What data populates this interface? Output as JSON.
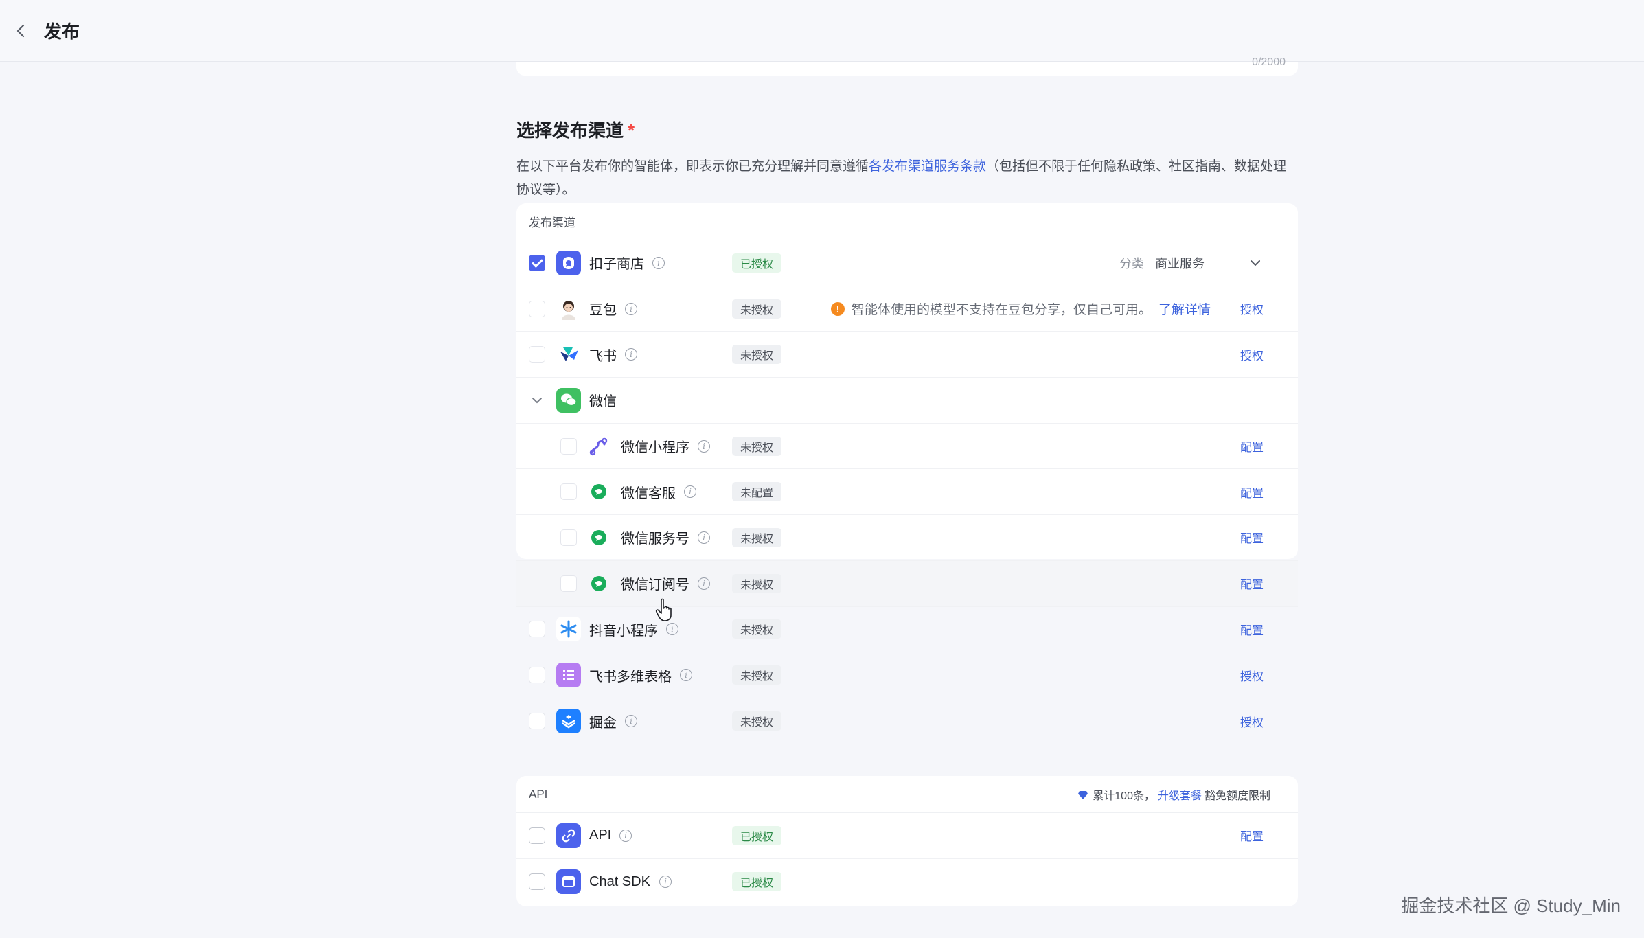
{
  "header": {
    "title": "发布"
  },
  "prev_field": {
    "counter": "0/2000"
  },
  "section": {
    "title": "选择发布渠道",
    "required_mark": "*",
    "desc_before": "在以下平台发布你的智能体，即表示你已充分理解并同意遵循",
    "desc_link": "各发布渠道服务条款",
    "desc_after": "（包括但不限于任何隐私政策、社区指南、数据处理协议等）。"
  },
  "channels": {
    "header": "发布渠道",
    "coze_store": {
      "name": "扣子商店",
      "badge": "已授权",
      "category_label": "分类",
      "category_value": "商业服务"
    },
    "doubao": {
      "name": "豆包",
      "badge": "未授权",
      "warning": "智能体使用的模型不支持在豆包分享，仅自己可用。",
      "warning_link": "了解详情",
      "action": "授权"
    },
    "feishu": {
      "name": "飞书",
      "badge": "未授权",
      "action": "授权"
    },
    "wechat": {
      "name": "微信"
    },
    "wechat_mini": {
      "name": "微信小程序",
      "badge": "未授权",
      "action": "配置"
    },
    "wechat_cs": {
      "name": "微信客服",
      "badge": "未配置",
      "action": "配置"
    },
    "wechat_service": {
      "name": "微信服务号",
      "badge": "未授权",
      "action": "配置"
    },
    "wechat_sub": {
      "name": "微信订阅号",
      "badge": "未授权",
      "action": "配置"
    },
    "douyin_mini": {
      "name": "抖音小程序",
      "badge": "未授权",
      "action": "配置"
    },
    "feishu_table": {
      "name": "飞书多维表格",
      "badge": "未授权",
      "action": "授权"
    },
    "juejin": {
      "name": "掘金",
      "badge": "未授权",
      "action": "授权"
    }
  },
  "api": {
    "header": "API",
    "quota_before": "累计100条，",
    "quota_link": "升级套餐",
    "quota_after": "豁免额度限制",
    "api_row": {
      "name": "API",
      "badge": "已授权",
      "action": "配置"
    },
    "sdk_row": {
      "name": "Chat SDK",
      "badge": "已授权"
    }
  },
  "watermark": "掘金技术社区 @ Study_Min",
  "colors": {
    "accent": "#3d63dd",
    "checkbox": "#4c62ec",
    "authorized_bg": "#e8f7ec",
    "authorized_text": "#2b8a47",
    "warning": "#f58a1f"
  }
}
